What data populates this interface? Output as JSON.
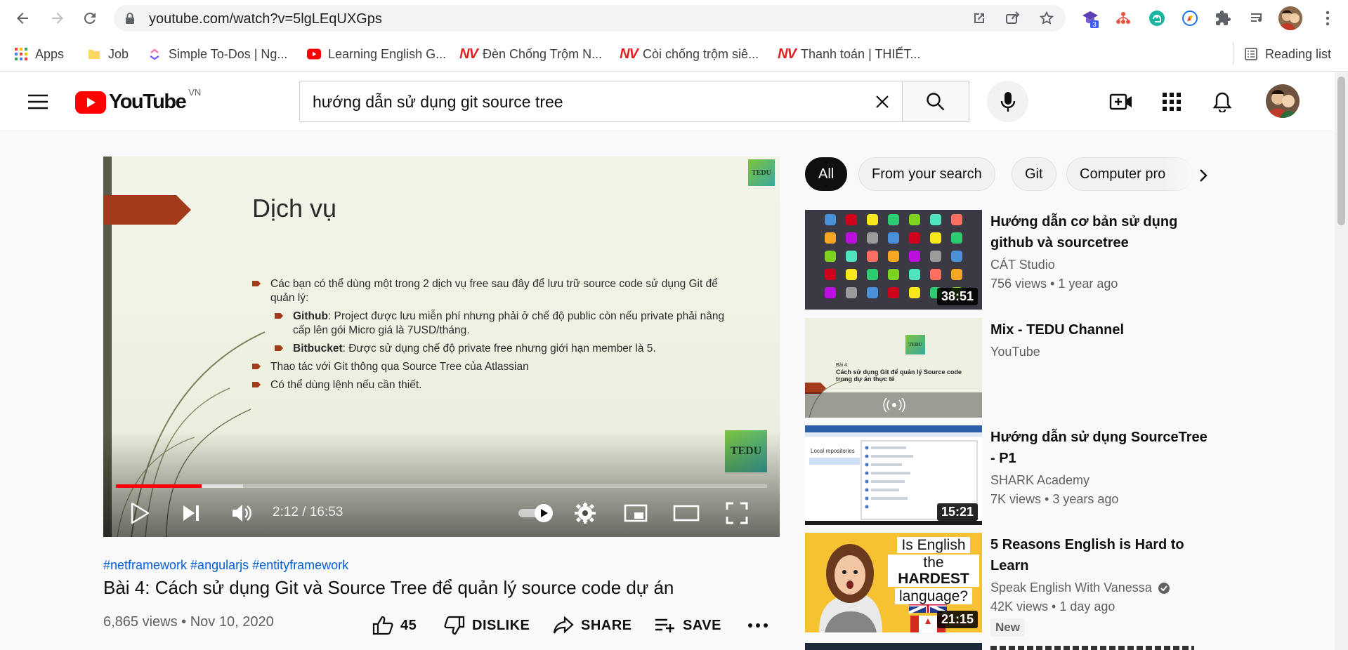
{
  "browser": {
    "url": "youtube.com/watch?v=5lgLEqUXGps",
    "extension_badge": "3",
    "bookmarks": [
      {
        "label": "Apps",
        "icon": "apps-grid-icon"
      },
      {
        "label": "Job",
        "icon": "folder-icon"
      },
      {
        "label": "Simple To-Dos | Ng...",
        "icon": "clickup-icon"
      },
      {
        "label": "Learning English G...",
        "icon": "youtube-icon"
      },
      {
        "label": "Đèn Chống Trộm N...",
        "icon": "nv-logo-icon"
      },
      {
        "label": "Còi chống trộm siê...",
        "icon": "nv-logo-icon"
      },
      {
        "label": "Thanh toán | THIẾT...",
        "icon": "nv-logo-icon"
      }
    ],
    "nv_text": "NV",
    "reading_list": "Reading list"
  },
  "youtube": {
    "logo_text": "YouTube",
    "country": "VN",
    "search_query": "hướng dẫn sử dụng git source tree"
  },
  "player": {
    "slide_title": "Dịch vụ",
    "slide_bullets": [
      "Các bạn có thể dùng một trong 2 dịch vụ free sau đây để lưu trữ source code sử dụng Git để quản lý:",
      "Thao tác với Git thông qua Source Tree của Atlassian",
      "Có thể dùng lệnh nếu cần thiết."
    ],
    "sub_bullets": [
      {
        "bold": "Github",
        "text": ": Project được lưu miễn phí nhưng phải ở chế độ public còn nếu private phải nâng cấp lên gói Micro giá là 7USD/tháng."
      },
      {
        "bold": "Bitbucket",
        "text": ": Được sử dụng chế độ private free nhưng giới hạn member là 5."
      }
    ],
    "badge_text": "TEDU",
    "time": "2:12 / 16:53",
    "played_fraction": 0.132,
    "buffered_fraction": 0.195
  },
  "video": {
    "hashtags": "#netframework #angularjs #entityframework",
    "title": "Bài 4: Cách sử dụng Git và Source Tree để quản lý source code dự án",
    "meta": "6,865 views • Nov 10, 2020",
    "likes": "45",
    "dislike_label": "DISLIKE",
    "share_label": "SHARE",
    "save_label": "SAVE"
  },
  "chips": [
    "All",
    "From your search",
    "Git",
    "Computer pro"
  ],
  "recommendations": [
    {
      "title": "Hướng dẫn cơ bản sử dụng github và sourcetree",
      "channel": "CÁT Studio",
      "stats": "756 views • 1 year ago",
      "duration": "38:51"
    },
    {
      "title": "Mix - TEDU Channel",
      "channel": "YouTube",
      "stats": "",
      "duration": "",
      "thumb_title": "Bài 4:",
      "thumb_text": "Cách sử dụng Git để quản lý Source code trong dự án thực tế"
    },
    {
      "title": "Hướng dẫn sử dụng SourceTree - P1",
      "channel": "SHARK Academy",
      "stats": "7K views • 3 years ago",
      "duration": "15:21",
      "thumb_label": "Local repositories"
    },
    {
      "title": "5 Reasons English is Hard to Learn",
      "channel": "Speak English With Vanessa",
      "stats": "42K views • 1 day ago",
      "duration": "21:15",
      "badge": "New",
      "thumb_line1": "Is English",
      "thumb_line2": "the",
      "thumb_line3": "HARDEST",
      "thumb_line4": "language?"
    }
  ],
  "colors": {
    "accent_red": "#ff0000",
    "link_blue": "#065fd4",
    "slide_red": "#a43a1c"
  }
}
